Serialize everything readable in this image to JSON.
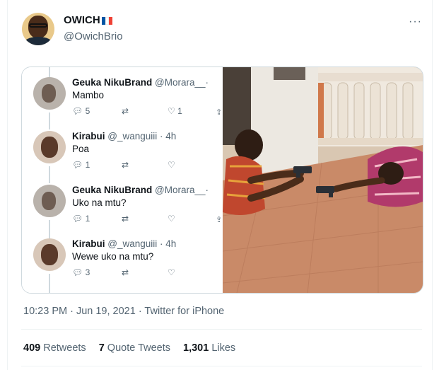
{
  "author": {
    "name": "OWICH",
    "handle": "@OwichBrio",
    "flag_colors": [
      "#0055a4",
      "#ffffff",
      "#ef4135"
    ]
  },
  "more_label": "···",
  "quoted_thread": [
    {
      "name": "Geuka NikuBrand",
      "handle": "@Morara__",
      "meta": "·",
      "text": "Mambo",
      "replies": "5",
      "likes": "1"
    },
    {
      "name": "Kirabui",
      "handle": "@_wanguiii",
      "meta": "· 4h",
      "text": "Poa",
      "replies": "1",
      "likes": ""
    },
    {
      "name": "Geuka NikuBrand",
      "handle": "@Morara__",
      "meta": "·",
      "text": "Uko na mtu?",
      "replies": "1",
      "likes": ""
    },
    {
      "name": "Kirabui",
      "handle": "@_wanguiii",
      "meta": "· 4h",
      "text": "Wewe uko na mtu?",
      "replies": "3",
      "likes": ""
    }
  ],
  "icons": {
    "reply": "reply-icon",
    "retweet": "retweet-icon",
    "like": "like-icon",
    "share": "share-icon"
  },
  "timestamp": "10:23 PM · Jun 19, 2021 · Twitter for iPhone",
  "stats": {
    "retweets_count": "409",
    "retweets_label": "Retweets",
    "quotes_count": "7",
    "quotes_label": "Quote Tweets",
    "likes_count": "1,301",
    "likes_label": "Likes"
  }
}
